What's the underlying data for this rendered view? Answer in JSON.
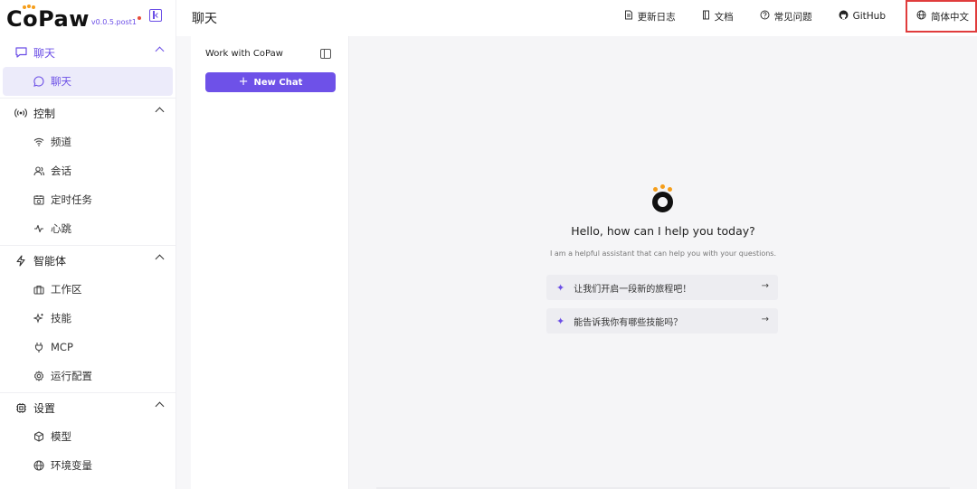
{
  "brand": {
    "name": "CoPaw",
    "version": "v0.0.5.post1"
  },
  "header": {
    "title": "聊天",
    "links": [
      {
        "label": "更新日志",
        "icon": "file-icon"
      },
      {
        "label": "文档",
        "icon": "book-icon"
      },
      {
        "label": "常见问题",
        "icon": "help-circle-icon"
      },
      {
        "label": "GitHub",
        "icon": "github-icon"
      },
      {
        "label": "简体中文",
        "icon": "globe-icon"
      }
    ]
  },
  "sidebar": {
    "groups": [
      {
        "label": "聊天",
        "icon": "message-square-icon",
        "items": [
          {
            "label": "聊天",
            "icon": "message-circle-icon"
          }
        ]
      },
      {
        "label": "控制",
        "icon": "broadcast-icon",
        "items": [
          {
            "label": "频道",
            "icon": "wifi-icon"
          },
          {
            "label": "会话",
            "icon": "users-icon"
          },
          {
            "label": "定时任务",
            "icon": "calendar-clock-icon"
          },
          {
            "label": "心跳",
            "icon": "activity-icon"
          }
        ]
      },
      {
        "label": "智能体",
        "icon": "zap-icon",
        "items": [
          {
            "label": "工作区",
            "icon": "briefcase-icon"
          },
          {
            "label": "技能",
            "icon": "sparkles-icon"
          },
          {
            "label": "MCP",
            "icon": "plug-icon"
          },
          {
            "label": "运行配置",
            "icon": "settings-icon"
          }
        ]
      },
      {
        "label": "设置",
        "icon": "cpu-icon",
        "items": [
          {
            "label": "模型",
            "icon": "box-icon"
          },
          {
            "label": "环境变量",
            "icon": "globe-icon"
          }
        ]
      }
    ]
  },
  "chat_panel": {
    "title": "Work with CoPaw",
    "new_chat": "New Chat"
  },
  "main": {
    "greeting": "Hello, how can I help you today?",
    "subtitle": "I am a helpful assistant that can help you with your questions.",
    "prompts": [
      "让我们开启一段新的旅程吧！",
      "能告诉我你有哪些技能吗？"
    ]
  },
  "colors": {
    "accent": "#6b4ee6",
    "logo_dot": "#f59e1b",
    "highlight_border": "#e03c3c"
  }
}
